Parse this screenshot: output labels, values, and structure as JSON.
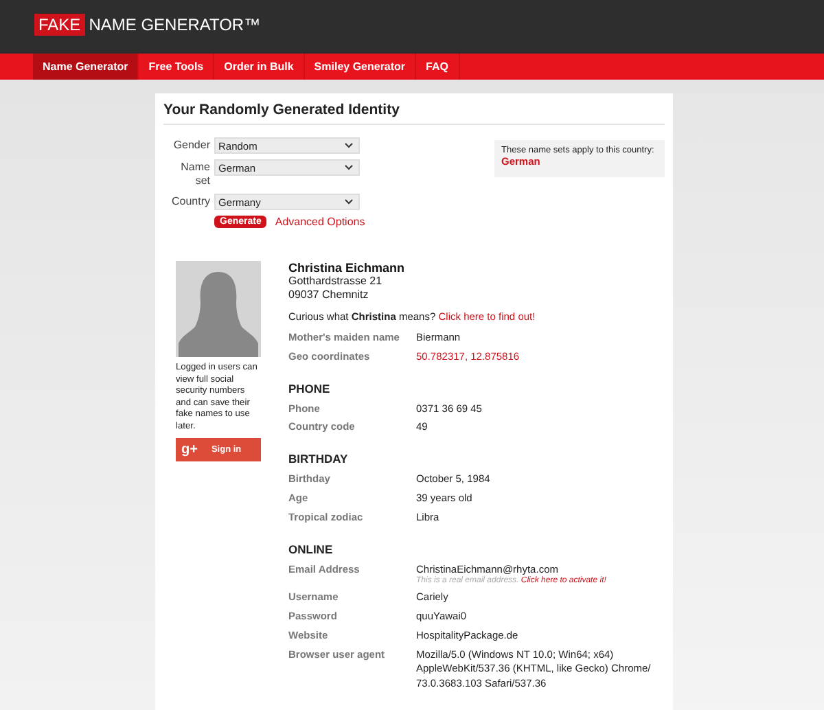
{
  "header": {
    "logo_box": "FAKE",
    "logo_text": "NAME GENERATOR™"
  },
  "nav": [
    {
      "label": "Name Generator",
      "selected": true
    },
    {
      "label": "Free Tools",
      "selected": false
    },
    {
      "label": "Order in Bulk",
      "selected": false
    },
    {
      "label": "Smiley Generator",
      "selected": false
    },
    {
      "label": "FAQ",
      "selected": false
    }
  ],
  "title": "Your Randomly Generated Identity",
  "form": {
    "fields": [
      {
        "label": "Gender",
        "value": "Random"
      },
      {
        "label": "Name set",
        "value": "German"
      },
      {
        "label": "Country",
        "value": "Germany"
      }
    ],
    "generate": "Generate",
    "advanced": "Advanced Options"
  },
  "info_box": {
    "text": "These name sets apply to this country:",
    "value": "German"
  },
  "login_note": "Logged in users can view full social security numbers and can save their fake names to use later.",
  "signin": {
    "icon": "g+",
    "label": "Sign in"
  },
  "identity": {
    "name": "Christina Eichmann",
    "address": [
      "Gotthardstrasse 21",
      "09037 Chemnitz"
    ],
    "curious": "Curious what **Christina** means?",
    "curious_link": "Click here to find out!"
  },
  "sections": [
    {
      "rows": [
        {
          "label": "Mother's maiden name",
          "value": "Biermann",
          "kind": "text"
        },
        {
          "label": "Geo coordinates",
          "value": "50.782317, 12.875816",
          "kind": "link"
        }
      ]
    },
    {
      "heading": "PHONE",
      "rows": [
        {
          "label": "Phone",
          "value": "0371 36 69 45",
          "kind": "text"
        },
        {
          "label": "Country code",
          "value": "49",
          "kind": "text"
        }
      ]
    },
    {
      "heading": "BIRTHDAY",
      "rows": [
        {
          "label": "Birthday",
          "value": "October 5, 1984",
          "kind": "text"
        },
        {
          "label": "Age",
          "value": "39 years old",
          "kind": "text"
        },
        {
          "label": "Tropical zodiac",
          "value": "Libra",
          "kind": "text"
        }
      ]
    },
    {
      "heading": "ONLINE",
      "rows": [
        {
          "label": "Email Address",
          "value": "ChristinaEichmann@rhyta.com",
          "kind": "text",
          "note": "This is a real email address.",
          "note_link": "Click here to activate it!"
        },
        {
          "label": "Username",
          "value": "Cariely",
          "kind": "text"
        },
        {
          "label": "Password",
          "value": "quuYawai0",
          "kind": "text"
        },
        {
          "label": "Website",
          "value": "HospitalityPackage.de",
          "kind": "text"
        },
        {
          "label": "Browser user agent",
          "value": "Mozilla/5.0 (Windows NT 10.0; Win64; x64) AppleWebKit/537.36 (KHTML, like Gecko) Chrome/ 73.0.3683.103 Safari/537.36",
          "kind": "text"
        }
      ]
    }
  ]
}
